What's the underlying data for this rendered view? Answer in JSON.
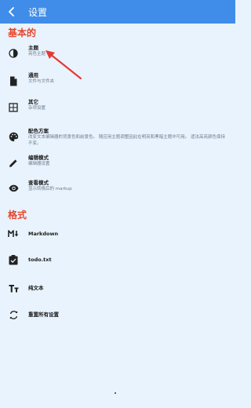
{
  "appbar": {
    "title": "设置",
    "back_icon": "arrow-back-icon"
  },
  "sections": [
    {
      "title": "基本的"
    },
    {
      "title": "格式"
    }
  ],
  "basic_items": [
    {
      "label": "主题",
      "desc": "亮色主题",
      "icon": "contrast-icon"
    },
    {
      "label": "通用",
      "desc": "文件与文件夹",
      "icon": "file-icon"
    },
    {
      "label": "其它",
      "desc": "杂项设置",
      "icon": "misc-icon"
    },
    {
      "label": "配色方案",
      "desc": "改变文本编辑器的背景色和前景色。 随应用主题调整因此在明亮和黑暗主题中可用。 适法高亮颜色保持不变。",
      "icon": "palette-icon"
    },
    {
      "label": "编辑模式",
      "desc": "编辑器设置",
      "icon": "pencil-icon"
    },
    {
      "label": "查看模式",
      "desc": "显示转换后的 markup",
      "icon": "eye-icon"
    }
  ],
  "format_items": [
    {
      "label": "Markdown",
      "icon": "markdown-icon"
    },
    {
      "label": "todo.txt",
      "icon": "checkbox-icon"
    },
    {
      "label": "纯文本",
      "icon": "text-icon"
    },
    {
      "label": "重置所有设置",
      "icon": "reset-icon"
    }
  ],
  "colors": {
    "appbar": "#3f8de8",
    "accent": "#e8452c",
    "background": "#e9f3fd"
  }
}
